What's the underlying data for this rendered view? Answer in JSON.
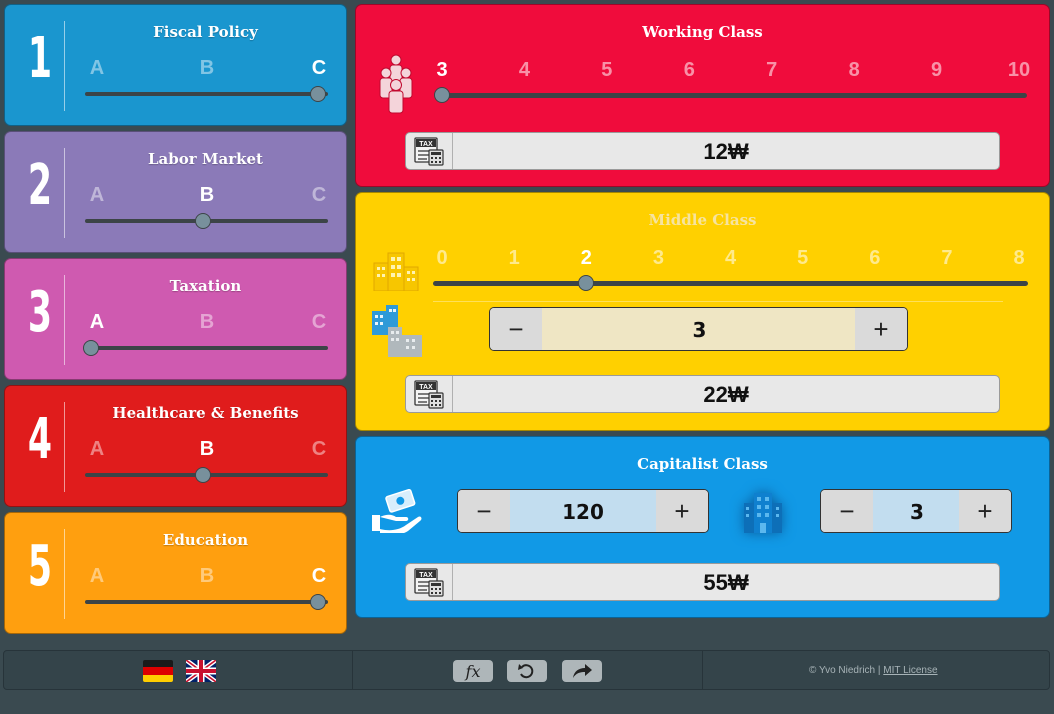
{
  "policies": [
    {
      "number": "1",
      "title": "Fiscal Policy",
      "options": [
        "A",
        "B",
        "C"
      ],
      "selected": 2,
      "color": "#1a96cf"
    },
    {
      "number": "2",
      "title": "Labor Market",
      "options": [
        "A",
        "B",
        "C"
      ],
      "selected": 1,
      "color": "#8b7ab8"
    },
    {
      "number": "3",
      "title": "Taxation",
      "options": [
        "A",
        "B",
        "C"
      ],
      "selected": 0,
      "color": "#cf5ab0"
    },
    {
      "number": "4",
      "title": "Healthcare & Benefits",
      "options": [
        "A",
        "B",
        "C"
      ],
      "selected": 1,
      "color": "#e01c1c"
    },
    {
      "number": "5",
      "title": "Education",
      "options": [
        "A",
        "B",
        "C"
      ],
      "selected": 2,
      "color": "#ff9f0f"
    }
  ],
  "working_class": {
    "title": "Working Class",
    "color": "#f00c3c",
    "scale": [
      "3",
      "4",
      "5",
      "6",
      "7",
      "8",
      "9",
      "10"
    ],
    "selected_index": 0,
    "icon": "workers-group-icon",
    "tax_label": "TAX",
    "tax": "12₩"
  },
  "middle_class": {
    "title": "Middle Class",
    "color": "#ffd000",
    "scale": [
      "0",
      "1",
      "2",
      "3",
      "4",
      "5",
      "6",
      "7",
      "8"
    ],
    "selected_index": 2,
    "icon": "building-icon",
    "companies_icon": "buildings-icon",
    "companies_value": "3",
    "tax_label": "TAX",
    "tax": "22₩"
  },
  "capitalist_class": {
    "title": "Capitalist Class",
    "color": "#1199e6",
    "capital_icon": "money-hand-icon",
    "capital_value": "120",
    "companies_icon": "office-building-icon",
    "companies_value": "3",
    "tax_label": "TAX",
    "tax": "55₩"
  },
  "footer": {
    "languages": [
      "german-flag-icon",
      "uk-flag-icon"
    ],
    "buttons": {
      "formula_label": "fx",
      "undo_icon": "undo-icon",
      "share_icon": "share-icon"
    },
    "credit": "© Yvo Niedrich |",
    "license": "MIT License"
  },
  "stepper": {
    "minus": "−",
    "plus": "+"
  }
}
